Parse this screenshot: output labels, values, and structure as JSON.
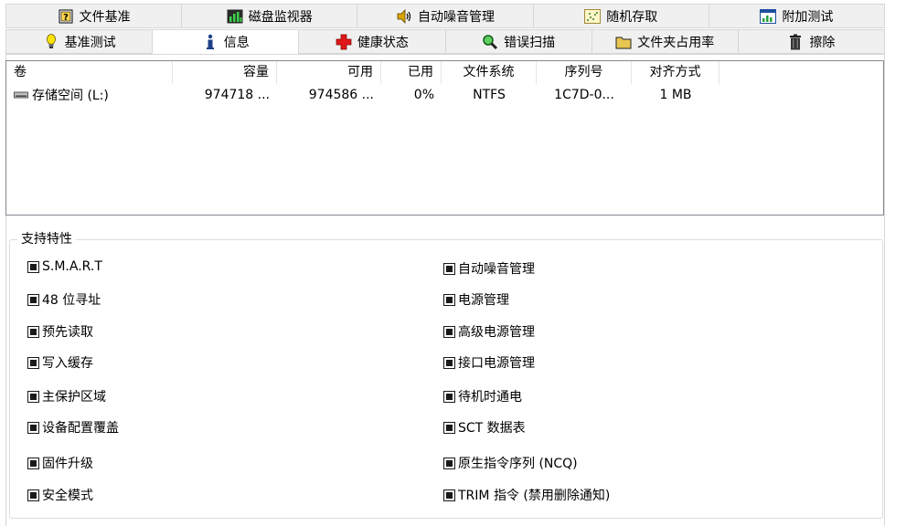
{
  "tabs_row1": [
    {
      "label": "文件基准",
      "icon": "help-icon"
    },
    {
      "label": "磁盘监视器",
      "icon": "bar-chart-icon"
    },
    {
      "label": "自动噪音管理",
      "icon": "speaker-icon"
    },
    {
      "label": "随机存取",
      "icon": "scatter-icon"
    },
    {
      "label": "附加测试",
      "icon": "window-chart-icon"
    }
  ],
  "tabs_row2": [
    {
      "label": "基准测试",
      "icon": "bulb-icon"
    },
    {
      "label": "信息",
      "icon": "info-icon"
    },
    {
      "label": "健康状态",
      "icon": "red-cross-icon"
    },
    {
      "label": "错误扫描",
      "icon": "magnifier-icon"
    },
    {
      "label": "文件夹占用率",
      "icon": "folder-icon"
    },
    {
      "label": "擦除",
      "icon": "trash-icon"
    }
  ],
  "volume_table": {
    "headers": [
      "卷",
      "容量",
      "可用",
      "已用",
      "文件系统",
      "序列号",
      "对齐方式"
    ],
    "rows": [
      [
        "存储空间 (L:)",
        "974718 ...",
        "974586 ...",
        "0%",
        "NTFS",
        "1C7D-0...",
        "1 MB"
      ]
    ]
  },
  "features": {
    "title": "支持特性",
    "left": [
      "S.M.A.R.T",
      "48 位寻址",
      "预先读取",
      "写入缓存",
      "主保护区域",
      "设备配置覆盖",
      "固件升级",
      "安全模式"
    ],
    "right": [
      "自动噪音管理",
      "电源管理",
      "高级电源管理",
      "接口电源管理",
      "待机时通电",
      "SCT 数据表",
      "原生指令序列 (NCQ)",
      "TRIM 指令 (禁用删除通知)"
    ]
  }
}
